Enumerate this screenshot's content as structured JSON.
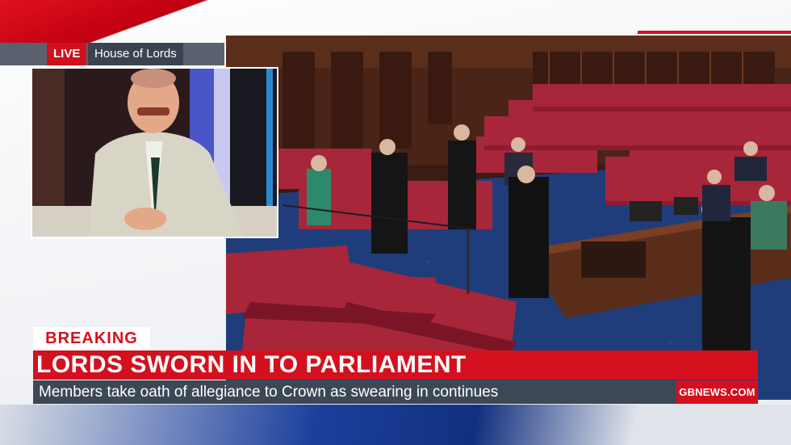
{
  "overlay": {
    "live_label": "LIVE",
    "location_label": "House of Lords",
    "breaking_label": "BREAKING",
    "headline": "LORDS SWORN IN TO PARLIAMENT",
    "subheadline": "Members take oath of allegiance to Crown as swearing in continues",
    "brand": "GBNEWS.COM"
  },
  "colors": {
    "accent_red": "#d4101e",
    "subline_bg": "#3d4857",
    "bench_red": "#a8263a",
    "carpet_blue": "#1f3d7a"
  },
  "icons": {
    "studio_guest": "presenter-figure",
    "chamber": "house-of-lords-chamber"
  }
}
